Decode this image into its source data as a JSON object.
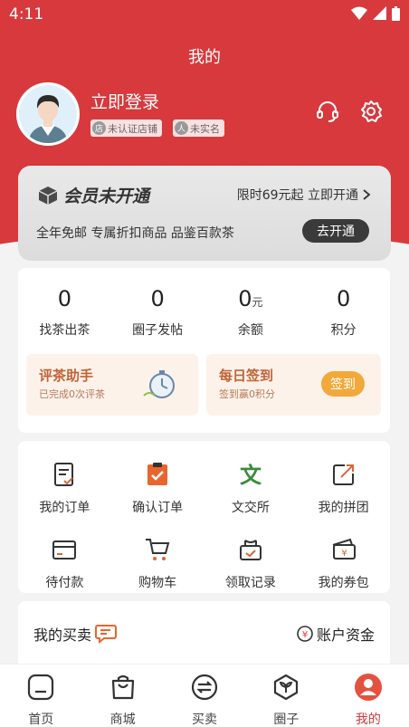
{
  "status_bar": {
    "time": "4:11"
  },
  "header": {
    "title": "我的"
  },
  "profile": {
    "login_text": "立即登录",
    "badges": [
      {
        "label": "未认证店铺",
        "icon": "store-icon"
      },
      {
        "label": "未实名",
        "icon": "person-icon"
      }
    ]
  },
  "vip": {
    "title": "会员未开通",
    "right_text": "限时69元起 立即开通",
    "description": "全年免邮 专属折扣商品 品鉴百款茶",
    "button_label": "去开通"
  },
  "stats": [
    {
      "value": "0",
      "unit": "",
      "label": "找茶出茶"
    },
    {
      "value": "0",
      "unit": "",
      "label": "圈子发帖"
    },
    {
      "value": "0",
      "unit": "元",
      "label": "余额"
    },
    {
      "value": "0",
      "unit": "",
      "label": "积分"
    }
  ],
  "promo": {
    "review": {
      "title": "评茶助手",
      "subtitle": "已完成0次评茶"
    },
    "signin": {
      "title": "每日签到",
      "subtitle": "签到赢0积分",
      "button_label": "签到"
    }
  },
  "menu": [
    {
      "label": "我的订单",
      "icon": "order-list-icon"
    },
    {
      "label": "确认订单",
      "icon": "confirm-order-icon"
    },
    {
      "label": "文交所",
      "icon": "exchange-wen-icon"
    },
    {
      "label": "我的拼团",
      "icon": "group-buy-icon"
    },
    {
      "label": "待付款",
      "icon": "wallet-icon"
    },
    {
      "label": "购物车",
      "icon": "cart-icon"
    },
    {
      "label": "领取记录",
      "icon": "gift-box-icon"
    },
    {
      "label": "我的券包",
      "icon": "coupon-icon"
    }
  ],
  "trade": {
    "title": "我的买卖",
    "right": "账户资金"
  },
  "tabs": [
    {
      "label": "首页",
      "icon": "home-icon"
    },
    {
      "label": "商城",
      "icon": "shop-bag-icon"
    },
    {
      "label": "买卖",
      "icon": "trade-icon"
    },
    {
      "label": "圈子",
      "icon": "circle-leaf-icon"
    },
    {
      "label": "我的",
      "icon": "profile-icon",
      "active": true
    }
  ],
  "colors": {
    "brand_red": "#d7393d",
    "orange": "#f2a93a",
    "promo_text": "#c26236"
  }
}
